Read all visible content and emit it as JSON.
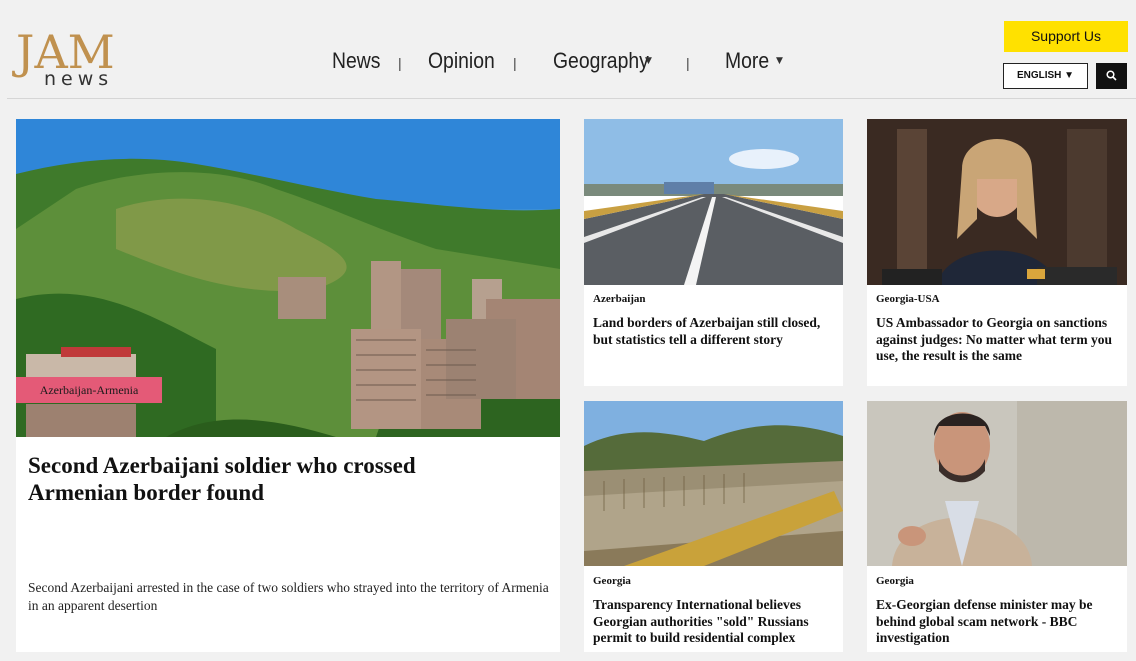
{
  "header": {
    "logo_top": "JAM",
    "logo_bottom": "news",
    "nav": [
      {
        "label": "News",
        "dropdown": false
      },
      {
        "label": "Opinion",
        "dropdown": false
      },
      {
        "label": "Geography",
        "dropdown": true
      },
      {
        "label": "More",
        "dropdown": true
      }
    ],
    "nav_separator": "|",
    "support_label": "Support Us",
    "language_label": "ENGLISH ▼",
    "accent_color": "#ffe100",
    "search_icon": "search-icon"
  },
  "main_story": {
    "badge": "Azerbaijan-Armenia",
    "badge_color": "#e45a77",
    "title": "Second Azerbaijani soldier who crossed Armenian border found",
    "summary": "Second Azerbaijani arrested in the case of two soldiers who strayed into the territory of Armenia in an apparent desertion"
  },
  "stories": [
    {
      "category": "Azerbaijan",
      "title": "Land borders of Azerbaijan still closed, but statistics tell a different story"
    },
    {
      "category": "Georgia-USA",
      "title": "US Ambassador to Georgia on sanctions against judges: No matter what term you use, the result is the same"
    },
    {
      "category": "Georgia",
      "title": "Transparency International believes Georgian authorities \"sold\" Russians permit to build residential complex"
    },
    {
      "category": "Georgia",
      "title": "Ex-Georgian defense minister may be behind global scam network - BBC investigation"
    }
  ]
}
